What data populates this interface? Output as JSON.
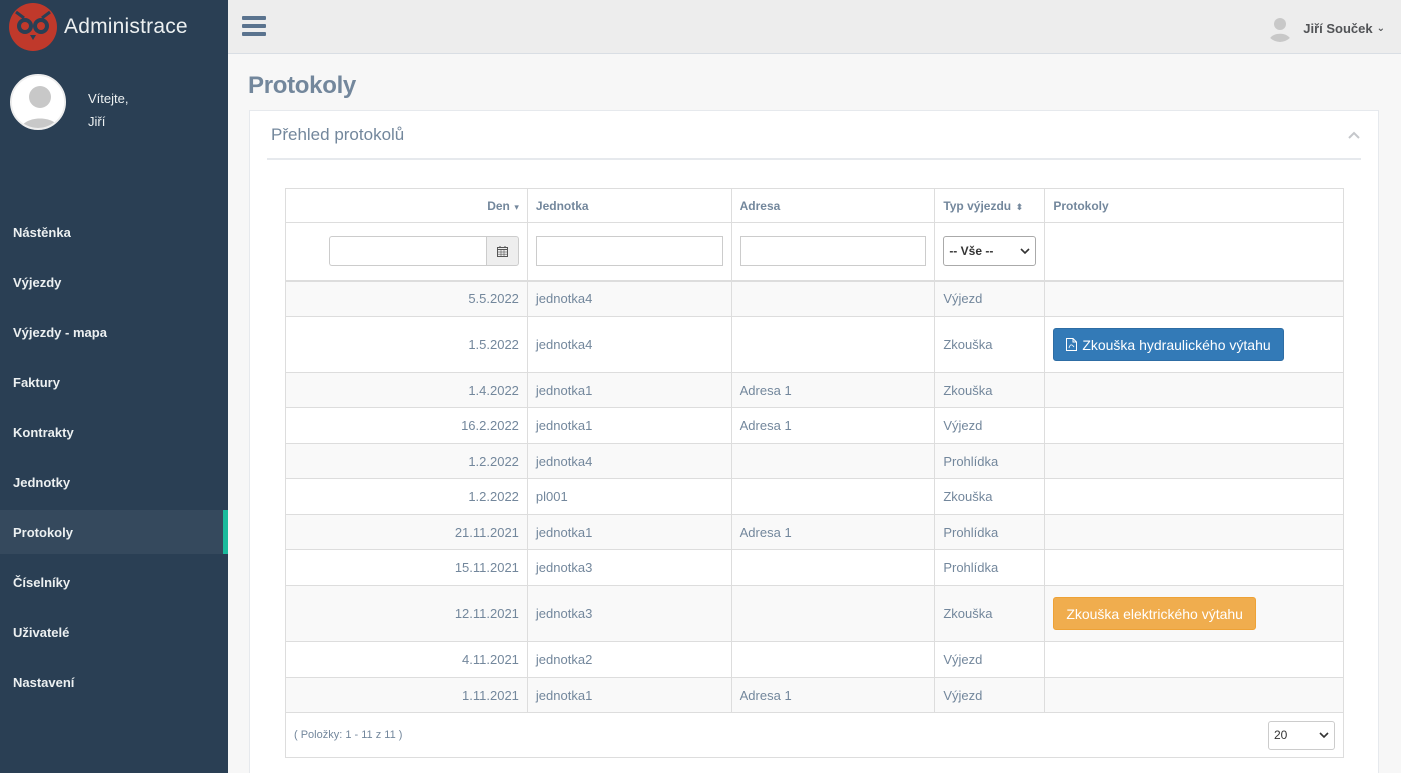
{
  "brand": {
    "title": "Administrace",
    "logo_color": "#c0392b"
  },
  "profile": {
    "greeting": "Vítejte,",
    "name": "Jiří"
  },
  "sidebar": {
    "items": [
      {
        "label": "Nástěnka"
      },
      {
        "label": "Výjezdy"
      },
      {
        "label": "Výjezdy - mapa"
      },
      {
        "label": "Faktury"
      },
      {
        "label": "Kontrakty"
      },
      {
        "label": "Jednotky"
      },
      {
        "label": "Protokoly",
        "active": true
      },
      {
        "label": "Číselníky"
      },
      {
        "label": "Uživatelé"
      },
      {
        "label": "Nastavení"
      }
    ]
  },
  "topbar": {
    "user_name": "Jiří Souček"
  },
  "page": {
    "title": "Protokoly"
  },
  "panel": {
    "title": "Přehled protokolů"
  },
  "table": {
    "columns": {
      "den": "Den",
      "jednotka": "Jednotka",
      "adresa": "Adresa",
      "typ": "Typ výjezdu",
      "protokoly": "Protokoly"
    },
    "filters": {
      "typ_selected": "-- Vše --"
    },
    "rows": [
      {
        "den": "5.5.2022",
        "jednotka": "jednotka4",
        "adresa": "",
        "typ": "Výjezd",
        "protokol": ""
      },
      {
        "den": "1.5.2022",
        "jednotka": "jednotka4",
        "adresa": "",
        "typ": "Zkouška",
        "protokol": "Zkouška hydraulického výtahu"
      },
      {
        "den": "1.4.2022",
        "jednotka": "jednotka1",
        "adresa": "Adresa 1",
        "typ": "Zkouška",
        "protokol": ""
      },
      {
        "den": "16.2.2022",
        "jednotka": "jednotka1",
        "adresa": "Adresa 1",
        "typ": "Výjezd",
        "protokol": ""
      },
      {
        "den": "1.2.2022",
        "jednotka": "jednotka4",
        "adresa": "",
        "typ": "Prohlídka",
        "protokol": ""
      },
      {
        "den": "1.2.2022",
        "jednotka": "pl001",
        "adresa": "",
        "typ": "Zkouška",
        "protokol": ""
      },
      {
        "den": "21.11.2021",
        "jednotka": "jednotka1",
        "adresa": "Adresa 1",
        "typ": "Prohlídka",
        "protokol": ""
      },
      {
        "den": "15.11.2021",
        "jednotka": "jednotka3",
        "adresa": "",
        "typ": "Prohlídka",
        "protokol": ""
      },
      {
        "den": "12.11.2021",
        "jednotka": "jednotka3",
        "adresa": "",
        "typ": "Zkouška",
        "protokol": "Zkouška elektrického výtahu"
      },
      {
        "den": "4.11.2021",
        "jednotka": "jednotka2",
        "adresa": "",
        "typ": "Výjezd",
        "protokol": ""
      },
      {
        "den": "1.11.2021",
        "jednotka": "jednotka1",
        "adresa": "Adresa 1",
        "typ": "Výjezd",
        "protokol": ""
      }
    ],
    "footer": {
      "summary": "( Položky: 1 - 11 z 11 )",
      "page_size": "20"
    }
  },
  "colors": {
    "sidebar": "#2a3f54",
    "active_accent": "#1abb9c",
    "btn_primary": "#337ab7",
    "btn_warning": "#f0ad4e"
  }
}
